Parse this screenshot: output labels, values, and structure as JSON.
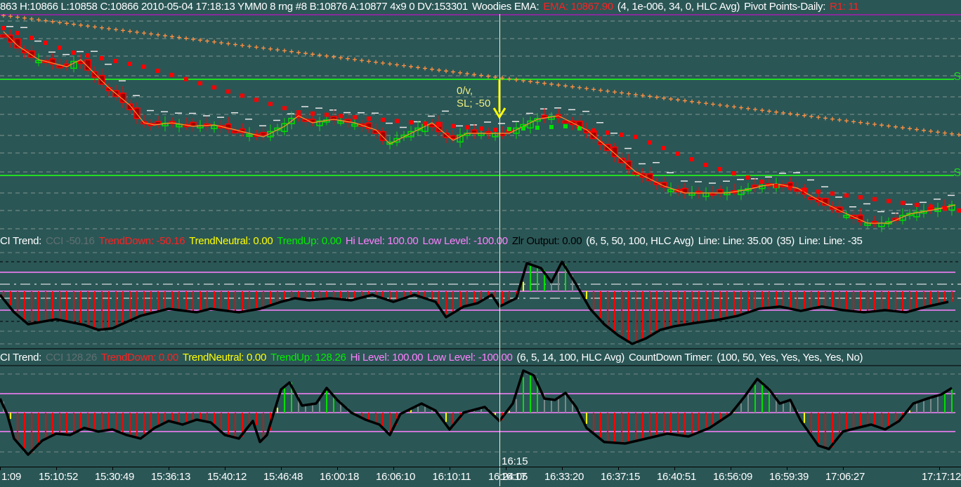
{
  "header": {
    "quote": "863 H:10866 L:10858 C:10866 2010-05-04 17:18:13 YMM0  8 rng  #8 B:10876 A:10877 4x9 0 DV:153301",
    "ema_label": "Woodies EMA:",
    "ema_value": "EMA: 10867.90",
    "ema_params": "(4, 1e-006, 34, 0, HLC Avg)",
    "pivot_label": "Pivot Points-Daily:",
    "pivot_value": "R1: 11"
  },
  "cci1": {
    "label": "CI Trend:",
    "cci": "CCI -50.16",
    "down": "TrendDown: -50.16",
    "neutral": "TrendNeutral: 0.00",
    "up": "TrendUp: 0.00",
    "hi": "Hi Level: 100.00",
    "low": "Low Level: -100.00",
    "zlr": "Zlr Output: 0.00",
    "params": "(6, 5, 50, 100, HLC Avg)",
    "line1": "Line:  Line: 35.00",
    "line1p": "(35)",
    "line2": "Line:  Line: -35"
  },
  "cci2": {
    "label": "CI Trend:",
    "cci": "CCI 128.26",
    "down": "TrendDown: 0.00",
    "neutral": "TrendNeutral: 0.00",
    "up": "TrendUp: 128.26",
    "hi": "Hi Level: 100.00",
    "low": "Low Level: -100.00",
    "params": "(6, 5, 14, 100, HLC Avg)",
    "timer_label": "CountDown Timer:",
    "timer_params": "(100, 50, Yes, Yes, Yes, Yes, No)"
  },
  "annotation": {
    "line1": "0/v,",
    "line2": "SL; -50"
  },
  "support_labels": [
    "S",
    "S"
  ],
  "cursor": {
    "time_axis": "16:17",
    "time_panel": "16:15",
    "bar": 71.1
  },
  "time_axis": [
    "1:09",
    "15:10:52",
    "15:30:49",
    "15:36:13",
    "15:40:12",
    "15:46:48",
    "16:00:18",
    "16:06:10",
    "16:10:11",
    "16:17",
    "16:24:05",
    "16:33:20",
    "16:37:15",
    "16:40:51",
    "16:56:09",
    "16:59:39",
    "17:06:27",
    "17:17:12"
  ],
  "colors": {
    "background": "#2b5656",
    "up": "#00e000",
    "down": "#ff0000",
    "neutral": "#ffff00",
    "level": "#ff80ff",
    "pivot": "#ff9040",
    "support": "#22dd22"
  },
  "chart_data": {
    "type": "line",
    "price": {
      "closes": [
        [
          0,
          10928.5
        ],
        [
          2,
          10923.5
        ],
        [
          5,
          10918.5
        ],
        [
          9,
          10916
        ],
        [
          11,
          10918.5
        ],
        [
          13,
          10913.5
        ],
        [
          15,
          10908.5
        ],
        [
          18,
          10902.25
        ],
        [
          20,
          10896
        ],
        [
          21.5,
          10895.25
        ],
        [
          24,
          10896
        ],
        [
          27,
          10894.75
        ],
        [
          30,
          10895.25
        ],
        [
          33,
          10893.5
        ],
        [
          37,
          10891
        ],
        [
          40,
          10894.75
        ],
        [
          42,
          10898.5
        ],
        [
          44,
          10896
        ],
        [
          47,
          10897.25
        ],
        [
          50,
          10896
        ],
        [
          53,
          10893.5
        ],
        [
          55,
          10888.5
        ],
        [
          58,
          10892.25
        ],
        [
          61,
          10896
        ],
        [
          64,
          10889.75
        ],
        [
          66,
          10892.25
        ],
        [
          70,
          10892.25
        ],
        [
          72,
          10892.25
        ],
        [
          74,
          10894.75
        ],
        [
          76,
          10897.25
        ],
        [
          79,
          10898.5
        ],
        [
          81,
          10896
        ],
        [
          83,
          10893.5
        ],
        [
          86,
          10887.25
        ],
        [
          90,
          10878.5
        ],
        [
          94,
          10873.5
        ],
        [
          97,
          10871
        ],
        [
          100,
          10871
        ],
        [
          103,
          10871
        ],
        [
          106,
          10872.25
        ],
        [
          108,
          10873.5
        ],
        [
          110,
          10874.25
        ],
        [
          113,
          10872.75
        ],
        [
          116,
          10868.5
        ],
        [
          119,
          10864.75
        ],
        [
          123,
          10860.25
        ],
        [
          126,
          10860.25
        ],
        [
          129,
          10863.5
        ],
        [
          133,
          10865.25
        ],
        [
          135.5,
          10866.75
        ]
      ],
      "ema": [
        [
          0,
          10929.75
        ],
        [
          10,
          10921
        ],
        [
          20,
          10916
        ],
        [
          42,
          10899.75
        ],
        [
          70,
          10893.5
        ],
        [
          80,
          10894.75
        ],
        [
          90,
          10891
        ],
        [
          100,
          10881
        ],
        [
          110,
          10873.5
        ],
        [
          136,
          10864.75
        ]
      ],
      "ema_green_range": [
        72,
        82
      ],
      "pivot_line": [
        [
          0,
          10934.25
        ],
        [
          70,
          10912.25
        ],
        [
          136,
          10891.75
        ]
      ],
      "supports": [
        10911.5,
        10877.25
      ]
    },
    "cci1": {
      "levels": {
        "hi": 100,
        "zero": 0,
        "low": -100
      },
      "values": [
        [
          0,
          -19
        ],
        [
          2,
          -111
        ],
        [
          4,
          -174
        ],
        [
          8,
          -148
        ],
        [
          12,
          -178
        ],
        [
          14,
          -204
        ],
        [
          16,
          -196
        ],
        [
          20,
          -130
        ],
        [
          24,
          -93
        ],
        [
          28,
          -111
        ],
        [
          30,
          -93
        ],
        [
          34,
          -111
        ],
        [
          37,
          -93
        ],
        [
          40,
          -56
        ],
        [
          42,
          -37
        ],
        [
          44,
          -48
        ],
        [
          47,
          -37
        ],
        [
          50,
          -48
        ],
        [
          53,
          -19
        ],
        [
          56,
          -56
        ],
        [
          59,
          -19
        ],
        [
          62,
          -56
        ],
        [
          63.5,
          -137
        ],
        [
          66,
          -81
        ],
        [
          68,
          -63
        ],
        [
          70,
          -19
        ],
        [
          71.1,
          -81
        ],
        [
          73.5,
          -37
        ],
        [
          75,
          148
        ],
        [
          77,
          122
        ],
        [
          78.5,
          48
        ],
        [
          80,
          155
        ],
        [
          82,
          37
        ],
        [
          84,
          -93
        ],
        [
          86,
          -174
        ],
        [
          88,
          -233
        ],
        [
          90,
          -278
        ],
        [
          92,
          -248
        ],
        [
          94,
          -204
        ],
        [
          96,
          -185
        ],
        [
          99,
          -167
        ],
        [
          102,
          -152
        ],
        [
          105,
          -130
        ],
        [
          108,
          -93
        ],
        [
          111,
          -81
        ],
        [
          114,
          -104
        ],
        [
          117,
          -81
        ],
        [
          120,
          -100
        ],
        [
          123,
          -111
        ],
        [
          126,
          -100
        ],
        [
          129,
          -111
        ],
        [
          132,
          -81
        ],
        [
          135,
          -56
        ]
      ]
    },
    "cci2": {
      "levels": {
        "hi": 100,
        "zero": 0,
        "low": -100
      },
      "values": [
        [
          0,
          74
        ],
        [
          1,
          -7
        ],
        [
          2,
          -137
        ],
        [
          4,
          -222
        ],
        [
          6,
          -148
        ],
        [
          8,
          -111
        ],
        [
          10,
          -118
        ],
        [
          12,
          -81
        ],
        [
          14,
          -100
        ],
        [
          16,
          -89
        ],
        [
          18,
          -118
        ],
        [
          20,
          -137
        ],
        [
          22,
          -81
        ],
        [
          24,
          -44
        ],
        [
          26,
          -63
        ],
        [
          28,
          -37
        ],
        [
          30,
          -52
        ],
        [
          32,
          -118
        ],
        [
          34,
          -137
        ],
        [
          36,
          -44
        ],
        [
          37,
          -155
        ],
        [
          38,
          -118
        ],
        [
          40,
          122
        ],
        [
          41.2,
          159
        ],
        [
          43,
          37
        ],
        [
          45,
          48
        ],
        [
          46.5,
          130
        ],
        [
          48,
          67
        ],
        [
          50,
          0
        ],
        [
          52,
          -37
        ],
        [
          54,
          -63
        ],
        [
          55.5,
          -118
        ],
        [
          57,
          -7
        ],
        [
          60,
          48
        ],
        [
          62,
          11
        ],
        [
          64,
          -89
        ],
        [
          66,
          0
        ],
        [
          69,
          30
        ],
        [
          71.1,
          -44
        ],
        [
          73,
          48
        ],
        [
          74.5,
          222
        ],
        [
          76,
          196
        ],
        [
          77.5,
          74
        ],
        [
          79,
          67
        ],
        [
          80.5,
          104
        ],
        [
          82,
          30
        ],
        [
          83.5,
          -81
        ],
        [
          86,
          -155
        ],
        [
          89,
          -163
        ],
        [
          92,
          -137
        ],
        [
          95,
          -111
        ],
        [
          98,
          -126
        ],
        [
          101,
          -81
        ],
        [
          104,
          -7
        ],
        [
          106,
          85
        ],
        [
          107.8,
          178
        ],
        [
          109.5,
          122
        ],
        [
          111,
          48
        ],
        [
          112.5,
          67
        ],
        [
          114,
          -44
        ],
        [
          116.5,
          -174
        ],
        [
          118,
          -192
        ],
        [
          120,
          -100
        ],
        [
          122,
          -81
        ],
        [
          124,
          -63
        ],
        [
          126,
          -89
        ],
        [
          128,
          -44
        ],
        [
          130,
          48
        ],
        [
          132,
          74
        ],
        [
          134,
          96
        ],
        [
          135.5,
          130
        ]
      ]
    }
  }
}
